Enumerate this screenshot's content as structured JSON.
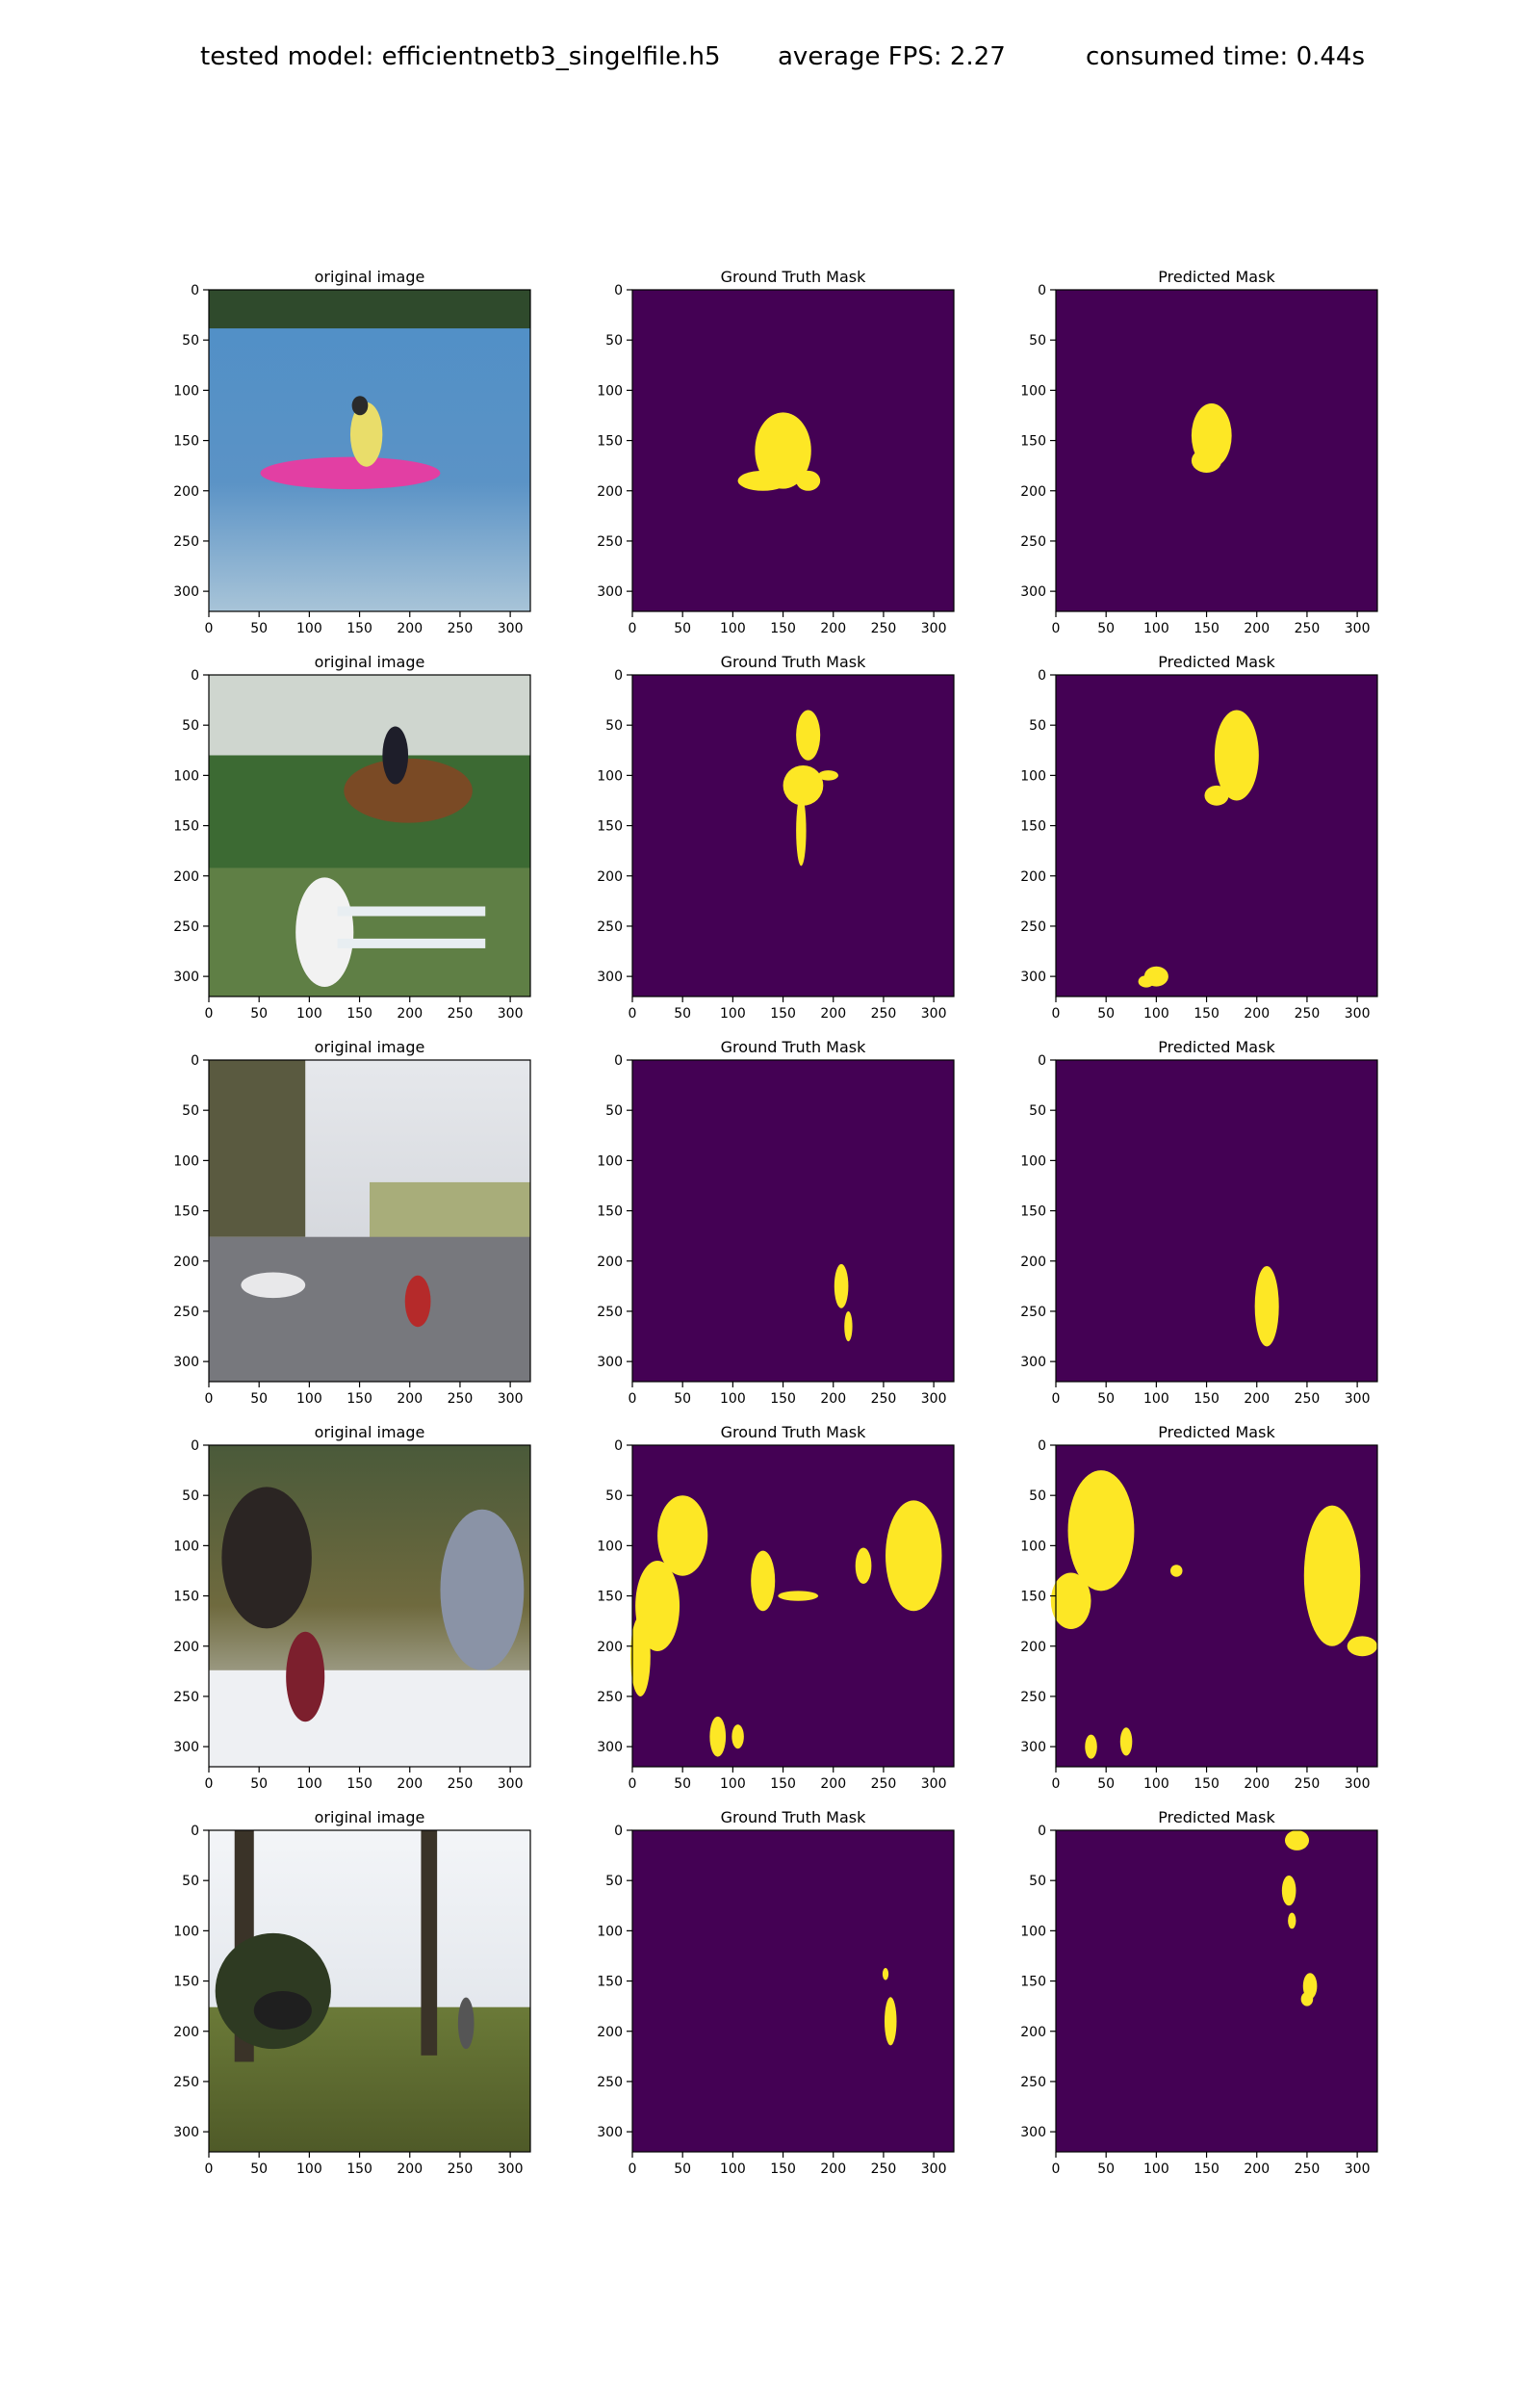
{
  "header": {
    "model_text": "tested model: efficientnetb3_singelfile.h5",
    "fps_text": "average FPS: 2.27",
    "time_text": "consumed time: 0.44s"
  },
  "colors": {
    "mask_background": "#440154",
    "mask_foreground": "#fde725",
    "axis": "#000000"
  },
  "chart_data": {
    "type": "image_grid",
    "rows": 5,
    "columns": [
      "original image",
      "Ground Truth Mask",
      "Predicted Mask"
    ],
    "xlim": [
      0,
      320
    ],
    "ylim": [
      320,
      0
    ],
    "xticks": [
      0,
      50,
      100,
      150,
      200,
      250,
      300
    ],
    "yticks": [
      0,
      50,
      100,
      150,
      200,
      250,
      300
    ],
    "grid": false,
    "panels": [
      {
        "row": 1,
        "scene": "person in pink kayak on lake",
        "gt_blobs": [
          [
            150,
            160,
            28,
            38
          ],
          [
            130,
            190,
            25,
            10
          ],
          [
            175,
            190,
            12,
            10
          ]
        ],
        "pred_blobs": [
          [
            155,
            145,
            20,
            32
          ],
          [
            150,
            170,
            15,
            12
          ]
        ]
      },
      {
        "row": 2,
        "scene": "rider on horse jumping fence",
        "gt_blobs": [
          [
            175,
            60,
            12,
            25
          ],
          [
            170,
            110,
            20,
            20
          ],
          [
            168,
            155,
            5,
            35
          ],
          [
            195,
            100,
            10,
            5
          ]
        ],
        "pred_blobs": [
          [
            180,
            80,
            22,
            45
          ],
          [
            160,
            120,
            12,
            10
          ],
          [
            100,
            300,
            12,
            10
          ],
          [
            90,
            305,
            8,
            6
          ]
        ]
      },
      {
        "row": 3,
        "scene": "street with cyclist and parked cars",
        "gt_blobs": [
          [
            208,
            225,
            7,
            22
          ],
          [
            215,
            265,
            4,
            15
          ]
        ],
        "pred_blobs": [
          [
            210,
            245,
            12,
            40
          ]
        ]
      },
      {
        "row": 4,
        "scene": "restaurant dinner table with people",
        "gt_blobs": [
          [
            50,
            90,
            25,
            40
          ],
          [
            25,
            160,
            22,
            45
          ],
          [
            8,
            210,
            10,
            40
          ],
          [
            280,
            110,
            28,
            55
          ],
          [
            230,
            120,
            8,
            18
          ],
          [
            130,
            135,
            12,
            30
          ],
          [
            165,
            150,
            20,
            5
          ],
          [
            85,
            290,
            8,
            20
          ],
          [
            105,
            290,
            6,
            12
          ]
        ],
        "pred_blobs": [
          [
            45,
            85,
            33,
            60
          ],
          [
            15,
            155,
            20,
            28
          ],
          [
            275,
            130,
            28,
            70
          ],
          [
            305,
            200,
            15,
            10
          ],
          [
            120,
            125,
            6,
            6
          ],
          [
            35,
            300,
            6,
            12
          ],
          [
            70,
            295,
            6,
            14
          ]
        ]
      },
      {
        "row": 5,
        "scene": "cow and person under trees in park",
        "gt_blobs": [
          [
            257,
            190,
            6,
            24
          ],
          [
            252,
            143,
            3,
            6
          ]
        ],
        "pred_blobs": [
          [
            240,
            10,
            12,
            10
          ],
          [
            232,
            60,
            7,
            15
          ],
          [
            235,
            90,
            4,
            8
          ],
          [
            253,
            155,
            7,
            13
          ],
          [
            250,
            168,
            6,
            7
          ]
        ]
      }
    ]
  }
}
